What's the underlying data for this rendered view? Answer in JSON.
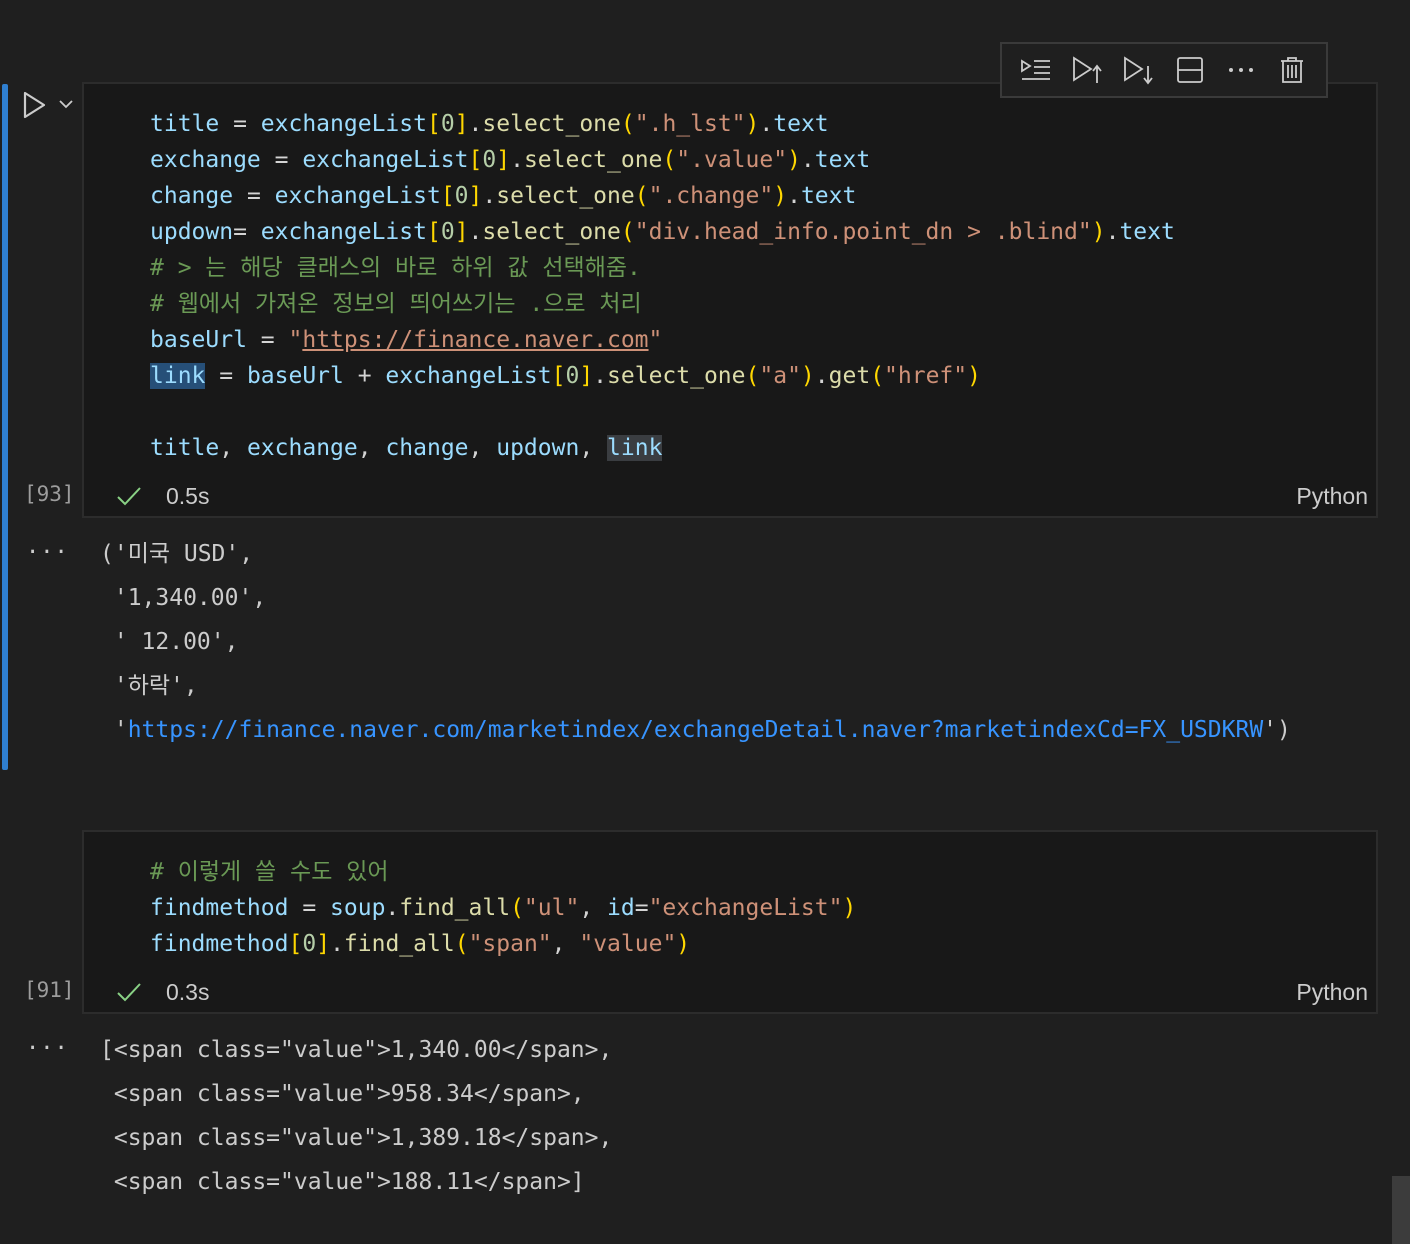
{
  "cells": [
    {
      "execution_count": "[93]",
      "status_time": "0.5s",
      "language": "Python",
      "code": [
        "title = exchangeList[0].select_one(\".h_lst\").text",
        "exchange = exchangeList[0].select_one(\".value\").text",
        "change = exchangeList[0].select_one(\".change\").text",
        "updown= exchangeList[0].select_one(\"div.head_info.point_dn > .blind\").text",
        "# > 는 해당 클래스의 바로 하위 값 선택해줌.",
        "# 웹에서 가져온 정보의 띄어쓰기는 .으로 처리",
        "baseUrl = \"https://finance.naver.com\"",
        "link = baseUrl + exchangeList[0].select_one(\"a\").get(\"href\")",
        "",
        "title, exchange, change, updown, link"
      ],
      "output": [
        "('미국 USD',",
        " '1,340.00',",
        " ' 12.00',",
        " '하락',",
        " 'https://finance.naver.com/marketindex/exchangeDetail.naver?marketindexCd=FX_USDKRW')"
      ],
      "output_link": "https://finance.naver.com/marketindex/exchangeDetail.naver?marketindexCd=FX_USDKRW"
    },
    {
      "execution_count": "[91]",
      "status_time": "0.3s",
      "language": "Python",
      "code": [
        "# 이렇게 쓸 수도 있어",
        "findmethod = soup.find_all(\"ul\", id=\"exchangeList\")",
        "findmethod[0].find_all(\"span\", \"value\")"
      ],
      "output": [
        "[<span class=\"value\">1,340.00</span>,",
        " <span class=\"value\">958.34</span>,",
        " <span class=\"value\">1,389.18</span>,",
        " <span class=\"value\">188.11</span>]"
      ]
    }
  ],
  "output_menu_label": "···",
  "toolbar_icons": [
    "execute-above-icon",
    "run-above-icon",
    "run-below-icon",
    "split-cell-icon",
    "more-icon",
    "delete-icon"
  ],
  "colors": {
    "background": "#1f1f1f",
    "cell_focus_bar": "#2f7fd0",
    "code_background": "#181818",
    "comment": "#6a9955",
    "string": "#ce9178",
    "variable": "#9cdcfe",
    "function": "#dcdcaa",
    "link": "#3794ff"
  }
}
